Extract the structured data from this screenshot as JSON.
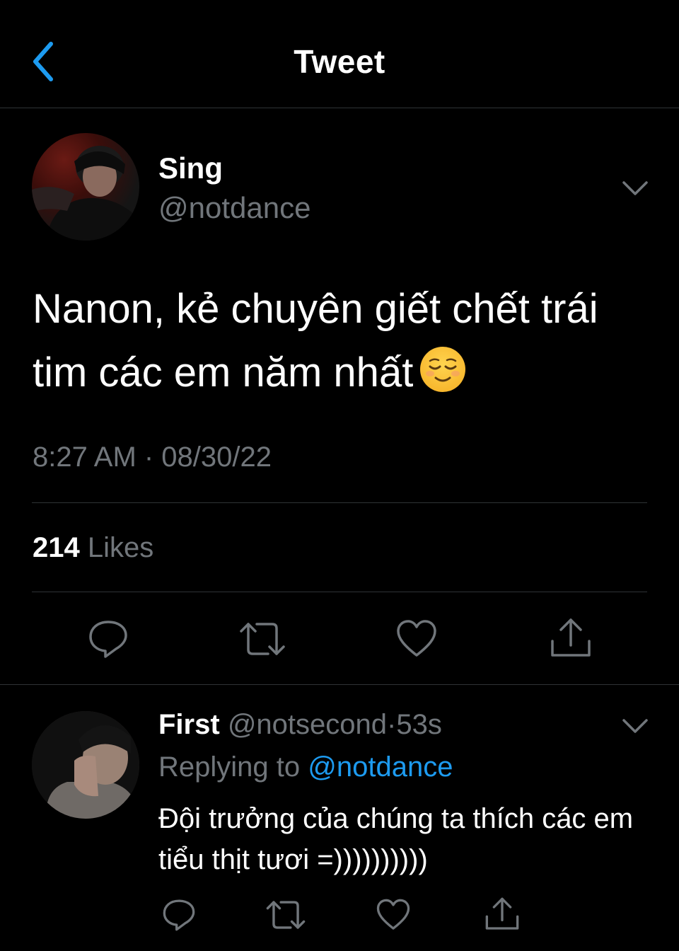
{
  "header": {
    "title": "Tweet",
    "back_icon": "chevron-left-icon",
    "accent_color": "#1d9bf0"
  },
  "tweet": {
    "author_name": "Sing",
    "author_handle": "@notdance",
    "text": "Nanon, kẻ chuyên giết chết trái tim các em năm nhất",
    "emoji": "relieved-face-emoji",
    "timestamp": "8:27 AM · 08/30/22",
    "likes_count": "214",
    "likes_label": "Likes",
    "actions": [
      "reply-icon",
      "retweet-icon",
      "like-icon",
      "share-icon"
    ]
  },
  "reply": {
    "author_name": "First",
    "author_handle": "@notsecond",
    "separator": "·",
    "time": "53s",
    "replying_prefix": "Replying to",
    "replying_handle": "@notdance",
    "text": "Đội trưởng của chúng ta thích các em tiểu thịt tươi =))))))))))",
    "actions": [
      "reply-icon",
      "retweet-icon",
      "like-icon",
      "share-icon"
    ]
  }
}
